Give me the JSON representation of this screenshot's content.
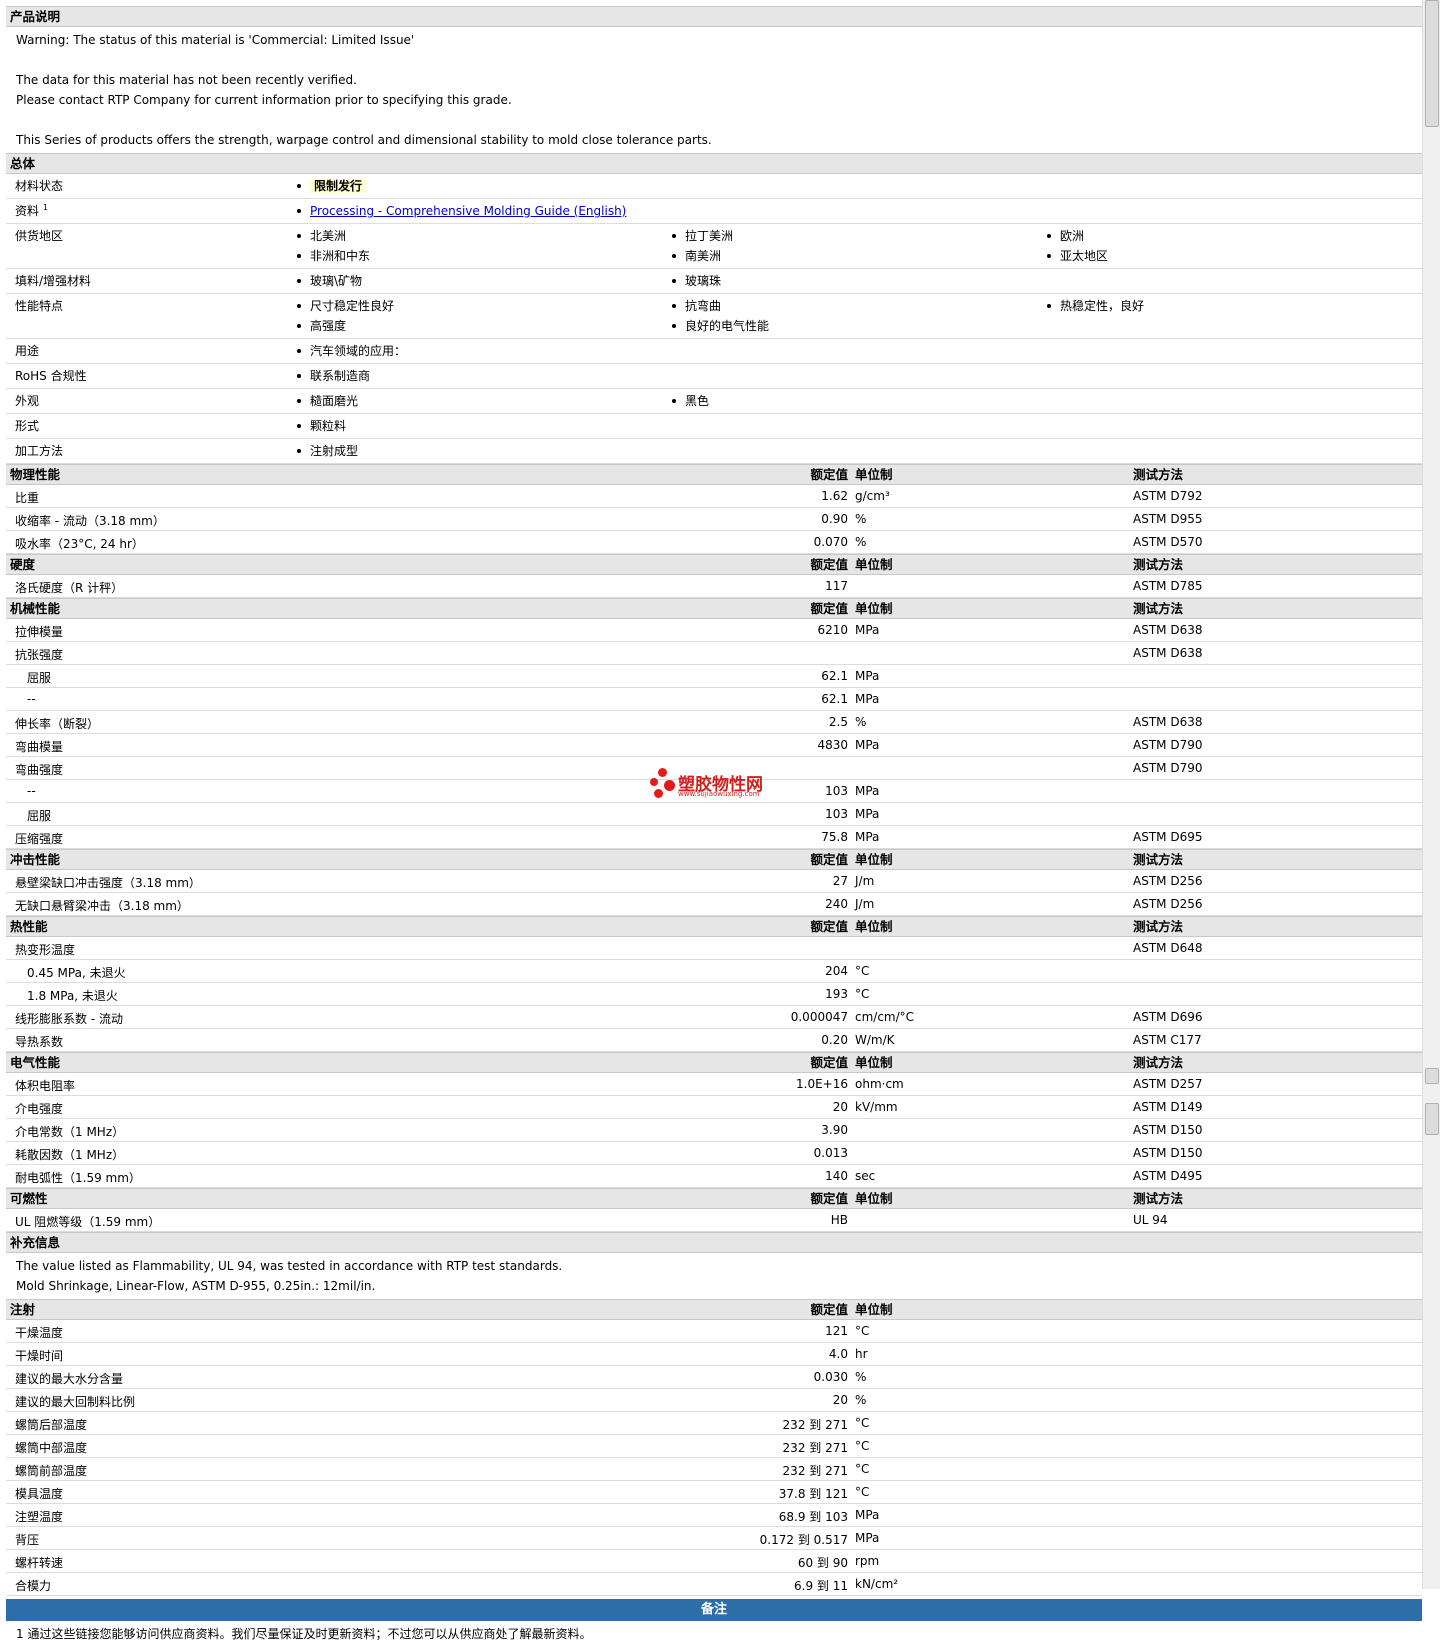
{
  "desc": {
    "title": "产品说明",
    "lines": [
      "Warning: The status of this material is 'Commercial: Limited Issue'",
      "",
      "The data for this material has not been recently verified.",
      "Please contact RTP Company for current information prior to specifying this grade.",
      "",
      "This Series of products offers the strength, warpage control and dimensional stability to mold close tolerance parts."
    ]
  },
  "general": {
    "title": "总体",
    "rows": [
      {
        "label": "材料状态",
        "sup": "",
        "values": [
          "限制发行"
        ],
        "highlight": true
      },
      {
        "label": "资料",
        "sup": "1",
        "values": [
          "Processing - Comprehensive Molding Guide (English)"
        ],
        "link": true
      },
      {
        "label": "供货地区",
        "sup": "",
        "values": [
          "北美洲",
          "拉丁美洲",
          "欧洲",
          "非洲和中东",
          "南美洲",
          "亚太地区"
        ]
      },
      {
        "label": "填料/增强材料",
        "sup": "",
        "values": [
          "玻璃\\矿物",
          "玻璃珠"
        ]
      },
      {
        "label": "性能特点",
        "sup": "",
        "values": [
          "尺寸稳定性良好",
          "抗弯曲",
          "热稳定性，良好",
          "高强度",
          "良好的电气性能"
        ]
      },
      {
        "label": "用途",
        "sup": "",
        "values": [
          "汽车领域的应用："
        ]
      },
      {
        "label": "RoHS 合规性",
        "sup": "",
        "values": [
          "联系制造商"
        ]
      },
      {
        "label": "外观",
        "sup": "",
        "values": [
          "糙面磨光",
          "黑色"
        ]
      },
      {
        "label": "形式",
        "sup": "",
        "values": [
          "颗粒料"
        ]
      },
      {
        "label": "加工方法",
        "sup": "",
        "values": [
          "注射成型"
        ]
      }
    ]
  },
  "headers": {
    "value": "额定值",
    "unit": "单位制",
    "test": "测试方法"
  },
  "sections": [
    {
      "title": "物理性能",
      "rows": [
        {
          "label": "比重",
          "value": "1.62",
          "unit": "g/cm³",
          "test": "ASTM D792"
        },
        {
          "label": "收缩率 - 流动（3.18 mm）",
          "value": "0.90",
          "unit": "%",
          "test": "ASTM D955"
        },
        {
          "label": "吸水率（23°C, 24 hr）",
          "value": "0.070",
          "unit": "%",
          "test": "ASTM D570"
        }
      ]
    },
    {
      "title": "硬度",
      "rows": [
        {
          "label": "洛氏硬度（R 计秤）",
          "value": "117",
          "unit": "",
          "test": "ASTM D785"
        }
      ]
    },
    {
      "title": "机械性能",
      "rows": [
        {
          "label": "拉伸模量",
          "value": "6210",
          "unit": "MPa",
          "test": "ASTM D638"
        },
        {
          "label": "抗张强度",
          "value": "",
          "unit": "",
          "test": "ASTM D638"
        },
        {
          "label": "屈服",
          "value": "62.1",
          "unit": "MPa",
          "test": "",
          "indent": true
        },
        {
          "label": "--",
          "value": "62.1",
          "unit": "MPa",
          "test": "",
          "indent": true
        },
        {
          "label": "伸长率（断裂）",
          "value": "2.5",
          "unit": "%",
          "test": "ASTM D638"
        },
        {
          "label": "弯曲模量",
          "value": "4830",
          "unit": "MPa",
          "test": "ASTM D790"
        },
        {
          "label": "弯曲强度",
          "value": "",
          "unit": "",
          "test": "ASTM D790"
        },
        {
          "label": "--",
          "value": "103",
          "unit": "MPa",
          "test": "",
          "indent": true
        },
        {
          "label": "屈服",
          "value": "103",
          "unit": "MPa",
          "test": "",
          "indent": true
        },
        {
          "label": "压缩强度",
          "value": "75.8",
          "unit": "MPa",
          "test": "ASTM D695"
        }
      ]
    },
    {
      "title": "冲击性能",
      "rows": [
        {
          "label": "悬壁梁缺口冲击强度（3.18 mm）",
          "value": "27",
          "unit": "J/m",
          "test": "ASTM D256"
        },
        {
          "label": "无缺口悬臂梁冲击（3.18 mm）",
          "value": "240",
          "unit": "J/m",
          "test": "ASTM D256"
        }
      ]
    },
    {
      "title": "热性能",
      "rows": [
        {
          "label": "热变形温度",
          "value": "",
          "unit": "",
          "test": "ASTM D648"
        },
        {
          "label": "0.45 MPa, 未退火",
          "value": "204",
          "unit": "°C",
          "test": "",
          "indent": true
        },
        {
          "label": "1.8 MPa, 未退火",
          "value": "193",
          "unit": "°C",
          "test": "",
          "indent": true
        },
        {
          "label": "线形膨胀系数 - 流动",
          "value": "0.000047",
          "unit": "cm/cm/°C",
          "test": "ASTM D696"
        },
        {
          "label": "导热系数",
          "value": "0.20",
          "unit": "W/m/K",
          "test": "ASTM C177"
        }
      ]
    },
    {
      "title": "电气性能",
      "rows": [
        {
          "label": "体积电阻率",
          "value": "1.0E+16",
          "unit": "ohm·cm",
          "test": "ASTM D257"
        },
        {
          "label": "介电强度",
          "value": "20",
          "unit": "kV/mm",
          "test": "ASTM D149"
        },
        {
          "label": "介电常数（1 MHz）",
          "value": "3.90",
          "unit": "",
          "test": "ASTM D150"
        },
        {
          "label": "耗散因数（1 MHz）",
          "value": "0.013",
          "unit": "",
          "test": "ASTM D150"
        },
        {
          "label": "耐电弧性（1.59 mm）",
          "value": "140",
          "unit": "sec",
          "test": "ASTM D495"
        }
      ]
    },
    {
      "title": "可燃性",
      "rows": [
        {
          "label": "UL 阻燃等级（1.59 mm）",
          "value": "HB",
          "unit": "",
          "test": "UL 94"
        }
      ]
    }
  ],
  "supplement": {
    "title": "补充信息",
    "lines": [
      "The value listed as Flammability, UL 94, was tested in accordance with RTP test standards.",
      "Mold Shrinkage, Linear-Flow, ASTM D-955, 0.25in.: 12mil/in."
    ]
  },
  "injection": {
    "title": "注射",
    "rows": [
      {
        "label": "干燥温度",
        "value": "121",
        "unit": "°C"
      },
      {
        "label": "干燥时间",
        "value": "4.0",
        "unit": "hr"
      },
      {
        "label": "建议的最大水分含量",
        "value": "0.030",
        "unit": "%"
      },
      {
        "label": "建议的最大回制料比例",
        "value": "20",
        "unit": "%"
      },
      {
        "label": "螺筒后部温度",
        "value": "232 到  271",
        "unit": "°C"
      },
      {
        "label": "螺筒中部温度",
        "value": "232 到  271",
        "unit": "°C"
      },
      {
        "label": "螺筒前部温度",
        "value": "232 到  271",
        "unit": "°C"
      },
      {
        "label": "模具温度",
        "value": "37.8 到  121",
        "unit": "°C"
      },
      {
        "label": "注塑温度",
        "value": "68.9 到  103",
        "unit": "MPa"
      },
      {
        "label": "背压",
        "value": "0.172 到  0.517",
        "unit": "MPa"
      },
      {
        "label": "螺杆转速",
        "value": "60 到  90",
        "unit": "rpm"
      },
      {
        "label": "合模力",
        "value": "6.9 到  11",
        "unit": "kN/cm²"
      }
    ]
  },
  "notes": {
    "title": "备注",
    "footnote": "1 通过这些链接您能够访问供应商资料。我们尽量保证及时更新资料；不过您可以从供应商处了解最新资料。"
  },
  "watermark": {
    "name": "塑胶物性网",
    "url": "www.sujiaowuxing.com"
  }
}
